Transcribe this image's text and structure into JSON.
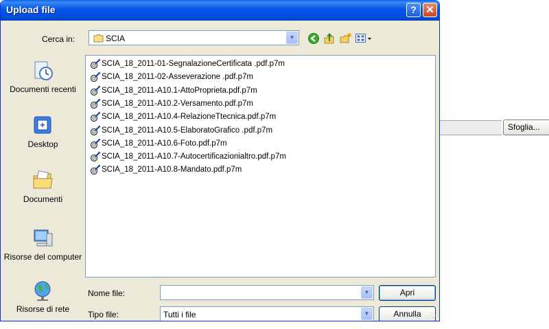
{
  "dialog": {
    "title": "Upload file",
    "help_icon": "help-icon",
    "close_icon": "close-icon"
  },
  "look_in": {
    "label": "Cerca in:",
    "value": "SCIA",
    "toolbar": [
      "back-icon",
      "up-folder-icon",
      "new-folder-icon",
      "view-menu-icon"
    ]
  },
  "places": [
    {
      "label": "Documenti recenti",
      "icon": "recent-documents-icon"
    },
    {
      "label": "Desktop",
      "icon": "desktop-icon"
    },
    {
      "label": "Documenti",
      "icon": "my-documents-icon"
    },
    {
      "label": "Risorse del computer",
      "icon": "my-computer-icon"
    },
    {
      "label": "Risorse di rete",
      "icon": "network-icon"
    }
  ],
  "files": [
    "SCIA_18_2011-01-SegnalazioneCertificata .pdf.p7m",
    "SCIA_18_2011-02-Asseverazione .pdf.p7m",
    "SCIA_18_2011-A10.1-AttoProprieta.pdf.p7m",
    "SCIA_18_2011-A10.2-Versamento.pdf.p7m",
    "SCIA_18_2011-A10.4-RelazioneTtecnica.pdf.p7m",
    "SCIA_18_2011-A10.5-ElaboratoGrafico .pdf.p7m",
    "SCIA_18_2011-A10.6-Foto.pdf.p7m",
    "SCIA_18_2011-A10.7-Autocertificazionialtro.pdf.p7m",
    "SCIA_18_2011-A10.8-Mandato.pdf.p7m"
  ],
  "file_name": {
    "label": "Nome file:",
    "value": ""
  },
  "file_type": {
    "label": "Tipo file:",
    "value": "Tutti i file"
  },
  "buttons": {
    "open": "Apri",
    "cancel": "Annulla"
  },
  "background": {
    "browse_label": "Sfoglia..."
  },
  "colors": {
    "titlebar": "#0054e3",
    "dialog_bg": "#ece9d8",
    "close": "#c64a24"
  }
}
